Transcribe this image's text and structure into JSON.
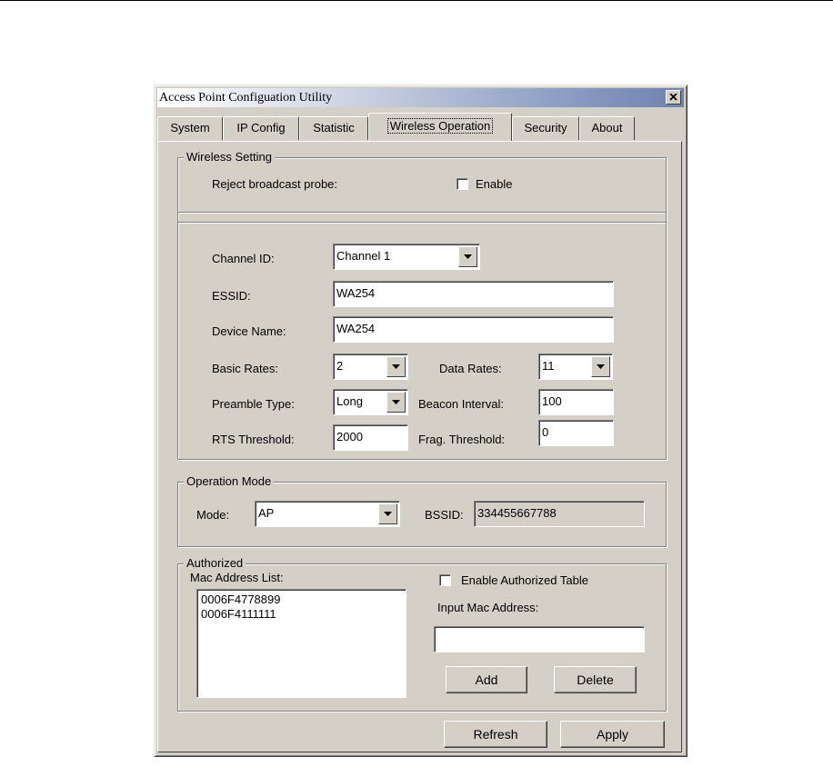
{
  "window": {
    "title": "Access Point Configuation Utility",
    "close_glyph": "×"
  },
  "tabs": [
    {
      "label": "System"
    },
    {
      "label": "IP Config"
    },
    {
      "label": "Statistic"
    },
    {
      "label": "Wireless Operation",
      "active": true
    },
    {
      "label": "Security"
    },
    {
      "label": "About"
    }
  ],
  "wireless_setting": {
    "group_label": "Wireless Setting",
    "reject_broadcast_probe_label": "Reject broadcast probe:",
    "enable_label": "Enable",
    "enable_checked": false
  },
  "settings": {
    "channel_id_label": "Channel ID:",
    "channel_id_value": "Channel 1",
    "essid_label": "ESSID:",
    "essid_value": "WA254",
    "device_name_label": "Device Name:",
    "device_name_value": "WA254",
    "basic_rates_label": "Basic Rates:",
    "basic_rates_value": "2",
    "data_rates_label": "Data Rates:",
    "data_rates_value": "11",
    "preamble_type_label": "Preamble Type:",
    "preamble_type_value": "Long",
    "beacon_interval_label": "Beacon Interval:",
    "beacon_interval_value": "100",
    "rts_threshold_label": "RTS Threshold:",
    "rts_threshold_value": "2000",
    "frag_threshold_label": "Frag. Threshold:",
    "frag_threshold_value": "0"
  },
  "operation_mode": {
    "group_label": "Operation Mode",
    "mode_label": "Mode:",
    "mode_value": "AP",
    "bssid_label": "BSSID:",
    "bssid_value": "334455667788"
  },
  "authorized": {
    "group_label": "Authorized",
    "mac_list_label": "Mac Address List:",
    "mac_list": [
      "0006F4778899",
      "0006F4111111"
    ],
    "enable_table_label": "Enable Authorized Table",
    "enable_table_checked": false,
    "input_mac_label": "Input Mac Address:",
    "input_mac_value": "",
    "add_label": "Add",
    "delete_label": "Delete"
  },
  "footer": {
    "refresh_label": "Refresh",
    "apply_label": "Apply"
  }
}
